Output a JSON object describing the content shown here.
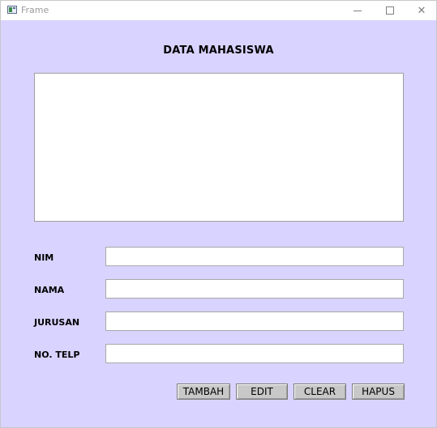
{
  "window": {
    "title": "Frame",
    "minimize_icon": "minimize-icon",
    "maximize_icon": "maximize-icon",
    "close_glyph": "✕"
  },
  "form": {
    "heading": "DATA MAHASISWA",
    "fields": [
      {
        "label": "NIM",
        "value": ""
      },
      {
        "label": "NAMA",
        "value": ""
      },
      {
        "label": "JURUSAN",
        "value": ""
      },
      {
        "label": "NO. TELP",
        "value": ""
      }
    ]
  },
  "buttons": {
    "tambah": "TAMBAH",
    "edit": "EDIT",
    "clear": "CLEAR",
    "hapus": "HAPUS"
  },
  "colors": {
    "background": "#d9d3ff",
    "button": "#c8c8c8"
  }
}
